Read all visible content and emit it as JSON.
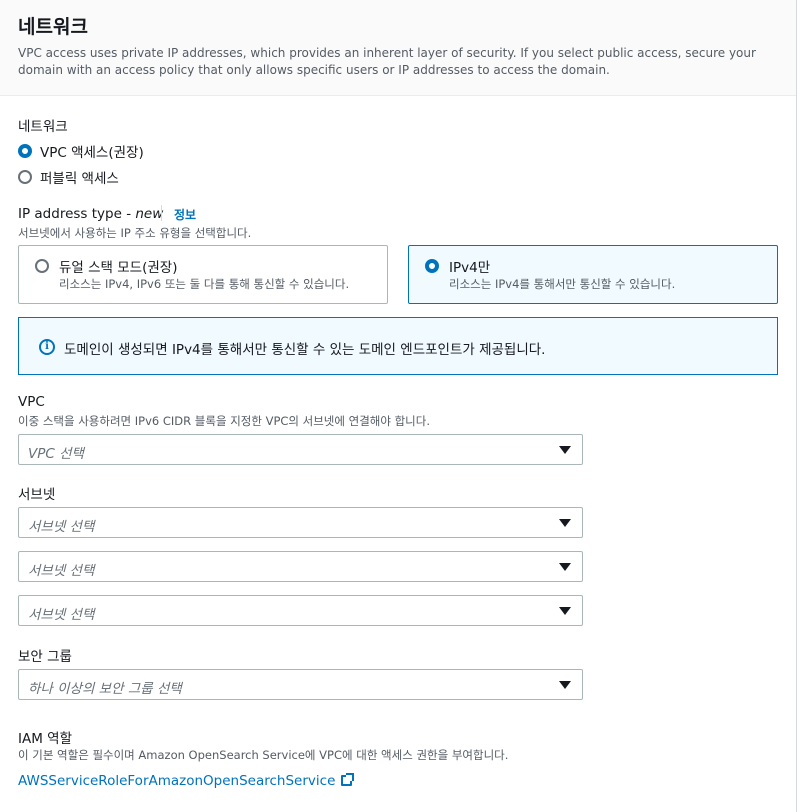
{
  "header": {
    "title": "네트워크",
    "description": "VPC access uses private IP addresses, which provides an inherent layer of security. If you select public access, secure your domain with an access policy that only allows specific users or IP addresses to access the domain."
  },
  "network": {
    "label": "네트워크",
    "options": [
      {
        "label": "VPC 액세스(권장)",
        "selected": true
      },
      {
        "label": "퍼블릭 액세스",
        "selected": false
      }
    ]
  },
  "ip_type": {
    "label": "IP address type - ",
    "label_new": "new",
    "info_link": "정보",
    "hint": "서브넷에서 사용하는 IP 주소 유형을 선택합니다.",
    "tiles": [
      {
        "title": "듀얼 스택 모드(권장)",
        "desc": "리소스는 IPv4, IPv6 또는 둘 다를 통해 통신할 수 있습니다.",
        "selected": false
      },
      {
        "title": "IPv4만",
        "desc": "리소스는 IPv4를 통해서만 통신할 수 있습니다.",
        "selected": true
      }
    ]
  },
  "info_alert": {
    "icon": "info-icon",
    "text": "도메인이 생성되면 IPv4를 통해서만 통신할 수 있는 도메인 엔드포인트가 제공됩니다."
  },
  "vpc": {
    "label": "VPC",
    "hint": "이중 스택을 사용하려면 IPv6 CIDR 블록을 지정한 VPC의 서브넷에 연결해야 합니다.",
    "placeholder": "VPC 선택"
  },
  "subnet": {
    "label": "서브넷",
    "placeholders": [
      "서브넷 선택",
      "서브넷 선택",
      "서브넷 선택"
    ]
  },
  "security_group": {
    "label": "보안 그룹",
    "placeholder": "하나 이상의 보안 그룹 선택"
  },
  "iam": {
    "label": "IAM 역할",
    "hint": "이 기본 역할은 필수이며 Amazon OpenSearch Service에 VPC에 대한 액세스 권한을 부여합니다.",
    "link": "AWSServiceRoleForAmazonOpenSearchService"
  },
  "colors": {
    "accent": "#0073bb",
    "text": "#16191f",
    "muted": "#545b64",
    "border": "#aab7b8",
    "selected_bg": "#f1faff"
  }
}
